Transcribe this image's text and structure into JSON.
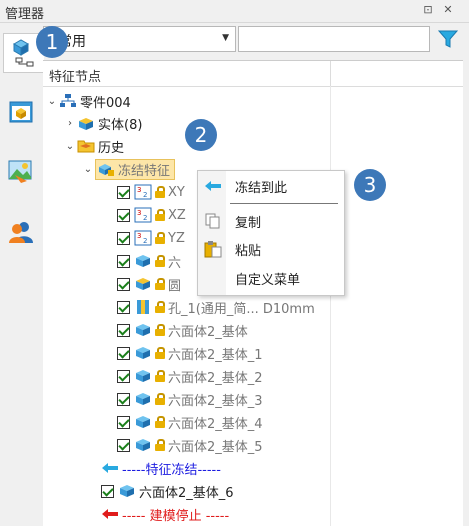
{
  "window": {
    "title": "管理器"
  },
  "toolbar": {
    "combo_value": "常用",
    "search_value": ""
  },
  "tree": {
    "column_header": "特征节点",
    "root": "零件004",
    "solid": "实体(8)",
    "history": "历史",
    "freeze_node": "冻结特征",
    "items": [
      "XY",
      "XZ",
      "YZ",
      "六",
      "圆",
      "孔_1(通用_简... D10mm",
      "六面体2_基体",
      "六面体2_基体_1",
      "六面体2_基体_2",
      "六面体2_基体_3",
      "六面体2_基体_4",
      "六面体2_基体_5"
    ],
    "freeze_divider": "-----特征冻结-----",
    "after_item": "六面体2_基体_6",
    "stop_divider": "----- 建模停止 -----"
  },
  "context_menu": {
    "items": [
      "冻结到此",
      "复制",
      "粘贴",
      "自定义菜单"
    ]
  },
  "callouts": [
    "1",
    "2",
    "3"
  ],
  "colors": {
    "accent": "#3d78b8",
    "freeze_highlight": "#fde6a8",
    "check": "#1a7f1a",
    "freeze_line": "#1c1ce0",
    "stop_line": "#e01c1c"
  }
}
